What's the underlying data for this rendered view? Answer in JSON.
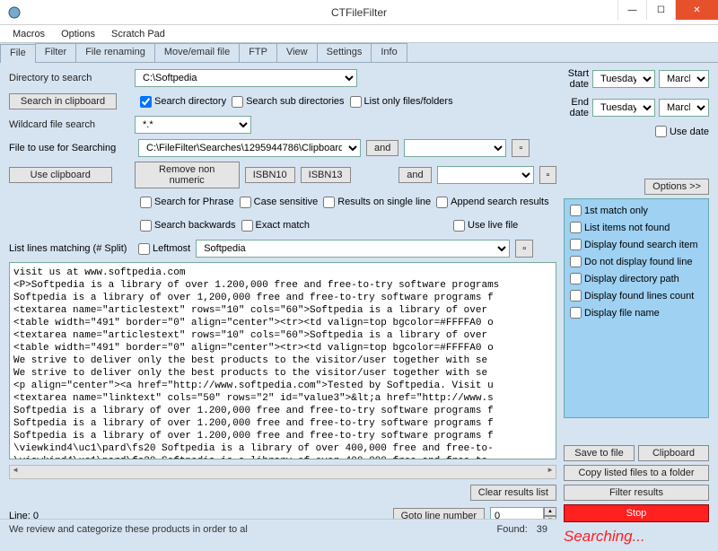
{
  "window": {
    "title": "CTFileFilter"
  },
  "menu": {
    "macros": "Macros",
    "options": "Options",
    "scratchpad": "Scratch Pad"
  },
  "tabs": [
    "File",
    "Filter",
    "File renaming",
    "Move/email file",
    "FTP",
    "View",
    "Settings",
    "Info"
  ],
  "dir": {
    "label": "Directory to search",
    "search_in_clipboard": "Search in clipboard",
    "value": "C:\\Softpedia",
    "search_directory": "Search directory",
    "search_subdirs": "Search sub directories",
    "list_only": "List only files/folders"
  },
  "wildcard": {
    "label": "Wildcard file search",
    "value": "*.*"
  },
  "filetouse": {
    "label": "File to use for Searching",
    "use_clipboard": "Use clipboard",
    "value": "C:\\FileFilter\\Searches\\1295944786\\Clipboard.txt",
    "and": "and"
  },
  "tools": {
    "remove_non_numeric": "Remove non numeric",
    "isbn10": "ISBN10",
    "isbn13": "ISBN13",
    "and": "and",
    "search_phrase": "Search for Phrase",
    "case_sensitive": "Case sensitive",
    "results_single": "Results on single line",
    "append_results": "Append search results",
    "search_backwards": "Search backwards",
    "exact_match": "Exact match",
    "use_live_file": "Use live file"
  },
  "listlines": {
    "label": "List lines matching (# Split)",
    "leftmost": "Leftmost",
    "value": "Softpedia"
  },
  "dates": {
    "start_label": "Start date",
    "end_label": "End date",
    "day": "Tuesday ,",
    "month": "March",
    "use_date": "Use date"
  },
  "rightopts": {
    "options_btn": "Options >>",
    "first_match": "1st match only",
    "list_not_found": "List items not found",
    "display_found": "Display found search item",
    "do_not_display_line": "Do not display found line",
    "display_dir_path": "Display directory path",
    "display_lines_count": "Display found lines count",
    "display_file_name": "Display file name"
  },
  "botright": {
    "save": "Save to file",
    "clipboard": "Clipboard",
    "copy_listed": "Copy listed files to a folder",
    "filter_results": "Filter results",
    "stop": "Stop",
    "searching": "Searching..."
  },
  "results_text": "visit us at www.softpedia.com\n<P>Softpedia is a library of over 1.200,000 free and free-to-try software programs\nSoftpedia is a library of over 1,200,000 free and free-to-try software programs f\n<textarea name=\"articlestext\" rows=\"10\" cols=\"60\">Softpedia is a library of over\n<table width=\"491\" border=\"0\" align=\"center\"><tr><td valign=top bgcolor=#FFFFA0 o\n<textarea name=\"articlestext\" rows=\"10\" cols=\"60\">Softpedia is a library of over\n<table width=\"491\" border=\"0\" align=\"center\"><tr><td valign=top bgcolor=#FFFFA0 o\nWe strive to deliver only the best products to the visitor/user together with se\nWe strive to deliver only the best products to the visitor/user together with se\n<p align=\"center\"><a href=\"http://www.softpedia.com\">Tested by Softpedia. Visit u\n<textarea name=\"linktext\" cols=\"50\" rows=\"2\" id=\"value3\">&lt;a href=\"http://www.s\nSoftpedia is a library of over 1.200,000 free and free-to-try software programs f\nSoftpedia is a library of over 1.200,000 free and free-to-try software programs f\nSoftpedia is a library of over 1.200,000 free and free-to-try software programs f\n\\viewkind4\\uc1\\pard\\fs20 Softpedia is a library of over 400,000 free and free-to-\n\\viewkind4\\uc1\\pard\\fs20 Softpedia is a library of over 400,000 free and free-to-\n<!--Visit us at www.softpedia.com-->Tested by Softpedia",
  "bottom": {
    "clear_results": "Clear results list",
    "line_label": "Line: 0",
    "goto_line": "Goto line number",
    "goto_val": "0",
    "found_label": "Found:",
    "found_val": "39",
    "status_tip": "We review and categorize these products in order to al"
  }
}
